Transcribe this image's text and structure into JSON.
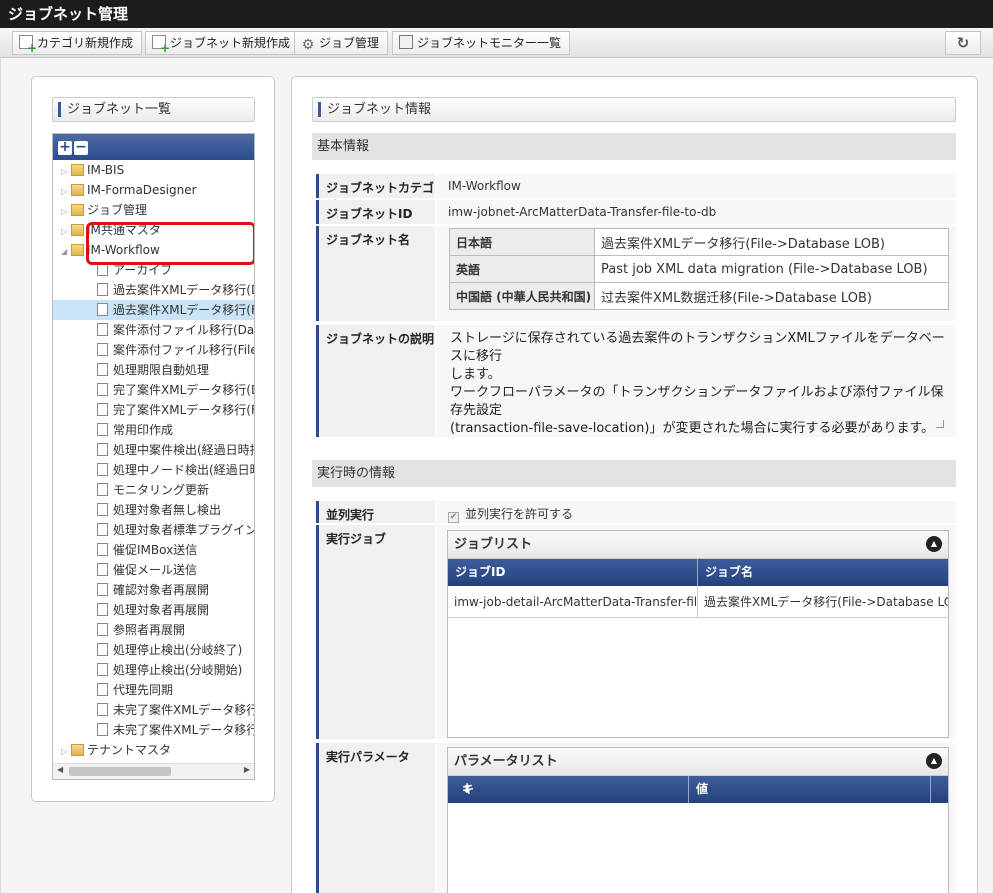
{
  "window": {
    "title": "ジョブネット管理"
  },
  "toolbar": {
    "buttons": [
      {
        "label": "カテゴリ新規作成",
        "icon": "new-document-icon"
      },
      {
        "label": "ジョブネット新規作成",
        "icon": "new-document-icon"
      },
      {
        "label": "ジョブ管理",
        "icon": "gear-icon"
      },
      {
        "label": "ジョブネットモニター一覧",
        "icon": "monitor-icon"
      }
    ],
    "refresh_icon": "refresh-icon",
    "refresh_glyph": "↻"
  },
  "sidebar": {
    "title": "ジョブネット一覧",
    "expand_glyph": "+",
    "collapse_glyph": "−",
    "tree": [
      {
        "label": "IM-BIS",
        "type": "folder",
        "level": 0,
        "toggle": "▷"
      },
      {
        "label": "IM-FormaDesigner",
        "type": "folder",
        "level": 0,
        "toggle": "▷"
      },
      {
        "label": "ジョブ管理",
        "type": "folder",
        "level": 0,
        "toggle": "▷"
      },
      {
        "label": "IM共通マスタ",
        "type": "folder",
        "level": 0,
        "toggle": "▷"
      },
      {
        "label": "IM-Workflow",
        "type": "folder",
        "level": 0,
        "toggle": "◢"
      },
      {
        "label": "アーカイブ",
        "type": "doc",
        "level": 1
      },
      {
        "label": "過去案件XMLデータ移行(D",
        "type": "doc",
        "level": 1
      },
      {
        "label": "過去案件XMLデータ移行(F",
        "type": "doc",
        "level": 1,
        "selected": true
      },
      {
        "label": "案件添付ファイル移行(Data",
        "type": "doc",
        "level": 1
      },
      {
        "label": "案件添付ファイル移行(File-",
        "type": "doc",
        "level": 1
      },
      {
        "label": "処理期限自動処理",
        "type": "doc",
        "level": 1
      },
      {
        "label": "完了案件XMLデータ移行(D",
        "type": "doc",
        "level": 1
      },
      {
        "label": "完了案件XMLデータ移行(F",
        "type": "doc",
        "level": 1
      },
      {
        "label": "常用印作成",
        "type": "doc",
        "level": 1
      },
      {
        "label": "処理中案件検出(経過日時指",
        "type": "doc",
        "level": 1
      },
      {
        "label": "処理中ノード検出(経過日時",
        "type": "doc",
        "level": 1
      },
      {
        "label": "モニタリング更新",
        "type": "doc",
        "level": 1
      },
      {
        "label": "処理対象者無し検出",
        "type": "doc",
        "level": 1
      },
      {
        "label": "処理対象者標準プラグイン検",
        "type": "doc",
        "level": 1
      },
      {
        "label": "催促IMBox送信",
        "type": "doc",
        "level": 1
      },
      {
        "label": "催促メール送信",
        "type": "doc",
        "level": 1
      },
      {
        "label": "確認対象者再展開",
        "type": "doc",
        "level": 1
      },
      {
        "label": "処理対象者再展開",
        "type": "doc",
        "level": 1
      },
      {
        "label": "参照者再展開",
        "type": "doc",
        "level": 1
      },
      {
        "label": "処理停止検出(分岐終了)",
        "type": "doc",
        "level": 1
      },
      {
        "label": "処理停止検出(分岐開始)",
        "type": "doc",
        "level": 1
      },
      {
        "label": "代理先同期",
        "type": "doc",
        "level": 1
      },
      {
        "label": "未完了案件XMLデータ移行",
        "type": "doc",
        "level": 1
      },
      {
        "label": "未完了案件XMLデータ移行",
        "type": "doc",
        "level": 1
      },
      {
        "label": "テナントマスタ",
        "type": "folder",
        "level": 0,
        "toggle": "▷"
      }
    ],
    "scroll_left": "◀",
    "scroll_right": "▶"
  },
  "detail": {
    "title": "ジョブネット情報",
    "basic_section": "基本情報",
    "category_label": "ジョブネットカテゴリ",
    "category_value": "IM-Workflow",
    "id_label": "ジョブネットID",
    "id_value": "imw-jobnet-ArcMatterData-Transfer-file-to-db",
    "name_label": "ジョブネット名",
    "names": [
      {
        "lang": "日本語",
        "value": "過去案件XMLデータ移行(File->Database LOB)"
      },
      {
        "lang": "英語",
        "value": "Past job XML data migration (File->Database LOB)"
      },
      {
        "lang": "中国語 (中華人民共和国)",
        "value": "过去案件XML数据迁移(File->Database LOB)"
      }
    ],
    "desc_label": "ジョブネットの説明",
    "desc_lines": [
      "ストレージに保存されている過去案件のトランザクションXMLファイルをデータベースに移行",
      "します。",
      "ワークフローパラメータの「トランザクションデータファイルおよび添付ファイル保存先設定",
      "(transaction-file-save-location)」が変更された場合に実行する必要があります。"
    ],
    "runtime_section": "実行時の情報",
    "parallel_label": "並列実行",
    "parallel_checkbox_label": "並列実行を許可する",
    "parallel_checked": true,
    "exec_job_label": "実行ジョブ",
    "job_list": {
      "title": "ジョブリスト",
      "toggle_glyph": "▲",
      "columns": [
        "ジョブID",
        "ジョブ名"
      ],
      "rows": [
        [
          "imw-job-detail-ArcMatterData-Transfer-file-to-",
          "過去案件XMLデータ移行(File->Database LOB"
        ]
      ]
    },
    "exec_param_label": "実行パラメータ",
    "param_list": {
      "title": "パラメータリスト",
      "toggle_glyph": "▲",
      "columns": [
        "キー",
        "値"
      ],
      "sort_glyph": "⬍"
    }
  },
  "colors": {
    "titlebar": "#1c1c1c",
    "accent": "#2d4b8c",
    "highlight_border": "#dd1111",
    "selected_row": "#c9e3f7"
  }
}
